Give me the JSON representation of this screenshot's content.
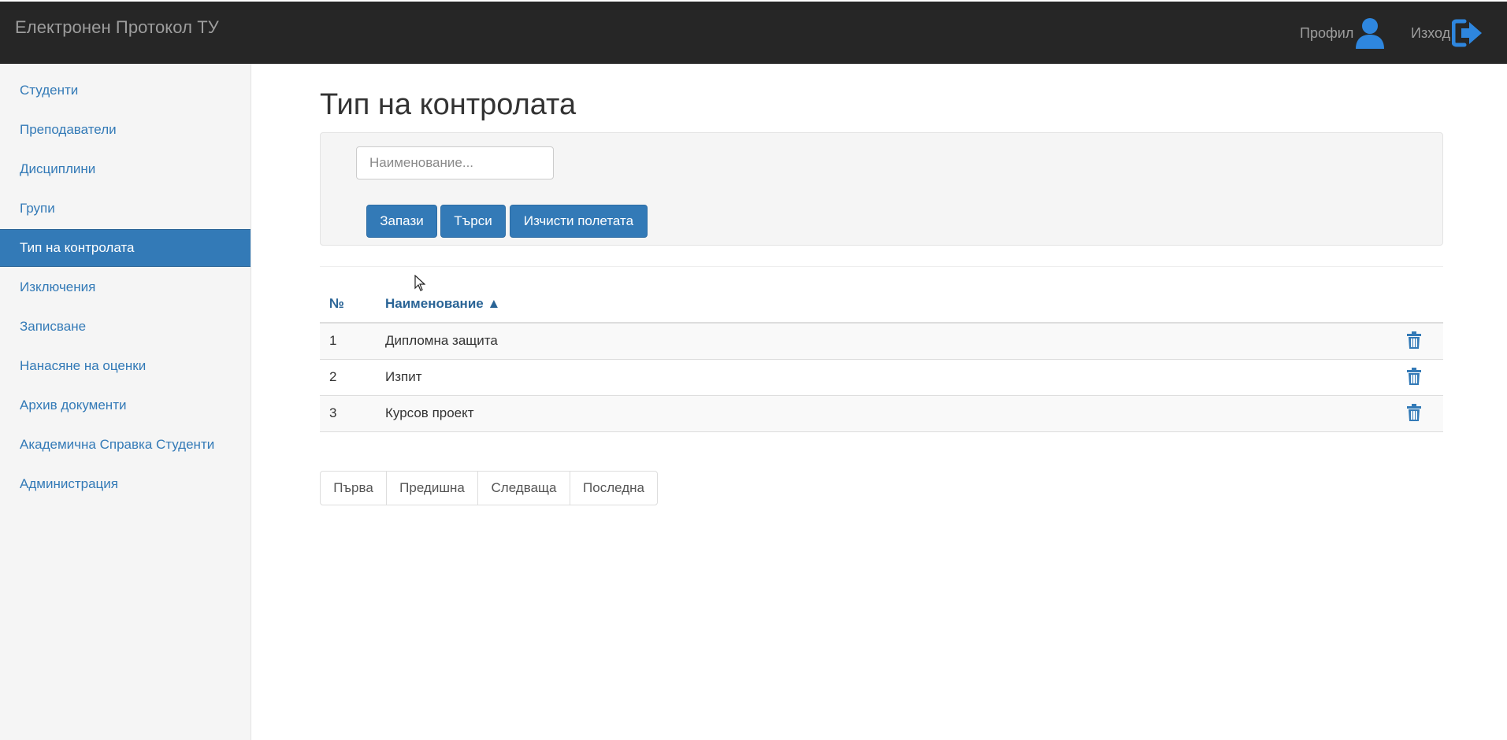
{
  "app": {
    "title": "Електронен Протокол ТУ",
    "profile_label": "Профил",
    "logout_label": "Изход",
    "accent_color": "#337ab7",
    "navbar_color": "#262626"
  },
  "sidebar": {
    "items": [
      {
        "label": "Студенти"
      },
      {
        "label": "Преподаватели"
      },
      {
        "label": "Дисциплини"
      },
      {
        "label": "Групи"
      },
      {
        "label": "Тип на контролата",
        "active": true
      },
      {
        "label": "Изключения"
      },
      {
        "label": "Записване"
      },
      {
        "label": "Нанасяне на оценки"
      },
      {
        "label": "Архив документи"
      },
      {
        "label": "Академична Справка Студенти"
      },
      {
        "label": "Администрация"
      }
    ]
  },
  "main": {
    "title": "Тип на контролата",
    "search": {
      "placeholder": "Наименование...",
      "value": ""
    },
    "buttons": {
      "save": "Запази",
      "search": "Търси",
      "clear": "Изчисти полетата"
    },
    "table": {
      "headers": {
        "num": "№",
        "name": "Наименование ▲"
      },
      "rows": [
        {
          "num": "1",
          "name": "Дипломна защита"
        },
        {
          "num": "2",
          "name": "Изпит"
        },
        {
          "num": "3",
          "name": "Курсов проект"
        }
      ]
    },
    "pagination": {
      "first": "Първа",
      "prev": "Предишна",
      "next": "Следваща",
      "last": "Последна"
    }
  },
  "icons": {
    "profile": "user-icon",
    "logout": "sign-out-icon",
    "delete": "trash-icon"
  }
}
